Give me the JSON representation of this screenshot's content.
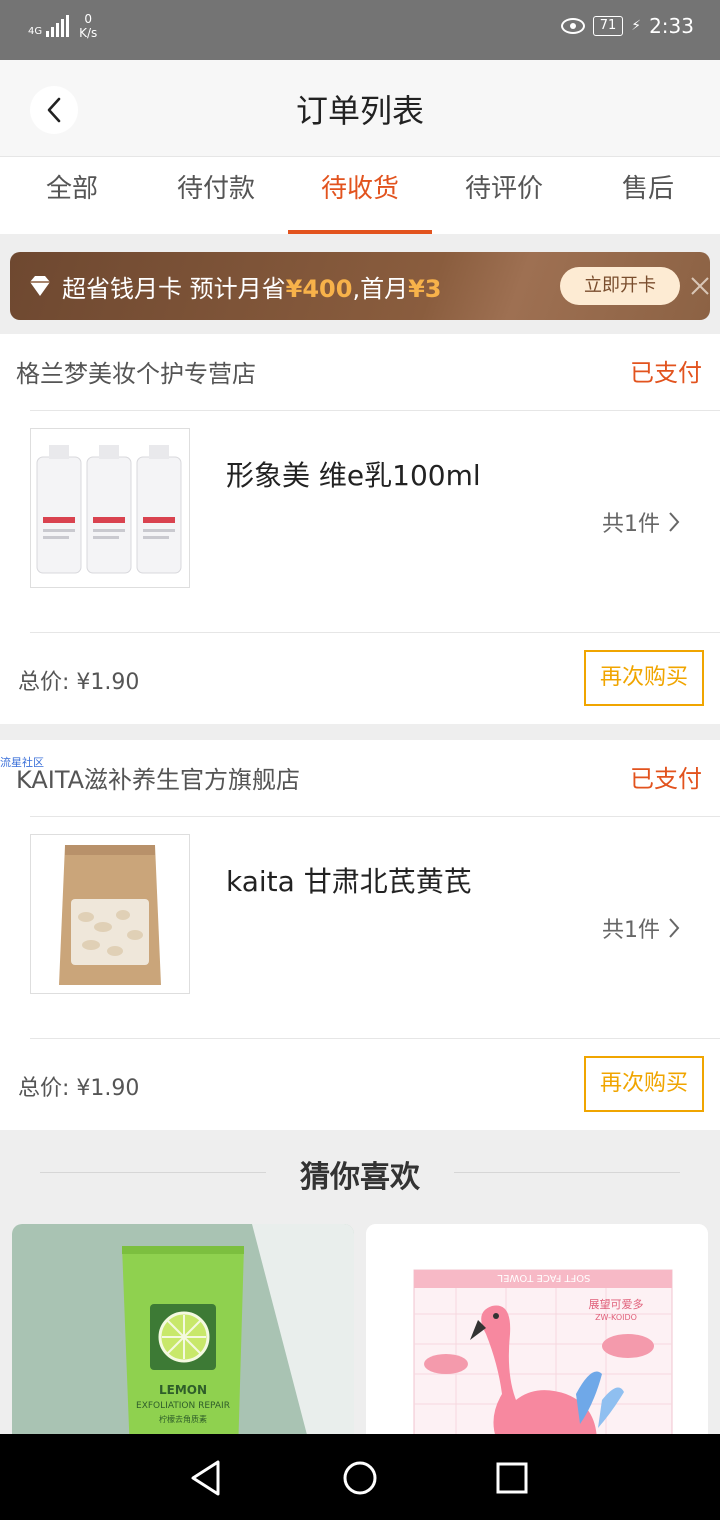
{
  "status_bar": {
    "network": "4G",
    "speed_value": "0",
    "speed_unit": "K/s",
    "battery": "71",
    "time": "2:33"
  },
  "header": {
    "title": "订单列表",
    "back_icon": "chevron-left-icon"
  },
  "tabs": [
    {
      "label": "全部",
      "active": false
    },
    {
      "label": "待付款",
      "active": false
    },
    {
      "label": "待收货",
      "active": true
    },
    {
      "label": "待评价",
      "active": false
    },
    {
      "label": "售后",
      "active": false
    }
  ],
  "promo": {
    "icon": "diamond-icon",
    "text_1": "超省钱月卡 预计月省",
    "amount_1": "¥400",
    "text_2": ",首月",
    "amount_2": "¥3",
    "button": "立即开卡",
    "close_icon": "close-icon"
  },
  "orders": [
    {
      "shop": "格兰梦美妆个护专营店",
      "status": "已支付",
      "item_name": "形象美 维e乳100ml",
      "count": "共1件",
      "total_label": "总价:",
      "total": "¥1.90",
      "rebuy": "再次购买"
    },
    {
      "shop": "KAITA滋补养生官方旗舰店",
      "status": "已支付",
      "item_name": "kaita 甘肃北芪黄芪",
      "count": "共1件",
      "total_label": "总价:",
      "total": "¥1.90",
      "rebuy": "再次购买"
    }
  ],
  "watermark": "流星社区",
  "recommend": {
    "title": "猜你喜欢",
    "cards": [
      {
        "brand": "LEMON",
        "subtitle": "EXFOLIATION REPAIR",
        "caption": "柠檬去角质素"
      },
      {
        "top_text": "SOFT FACE TOWEL",
        "brand_cn": "展望可爱多",
        "brand_en": "ZW-KOIDO"
      }
    ]
  },
  "colors": {
    "accent": "#e2531e",
    "rebuy": "#f0a500",
    "promo_bg": "#7a5034",
    "promo_highlight": "#f7b24a"
  }
}
